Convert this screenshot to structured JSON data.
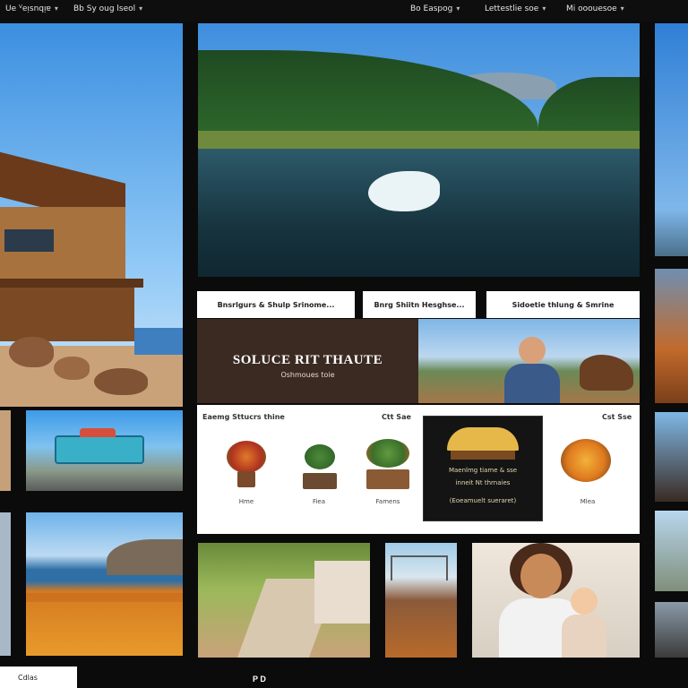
{
  "topbar": {
    "left_links": [
      "Ue ⱽeᴉsnqᴉɐ",
      "Bb Sy oug lseol"
    ],
    "right_links": [
      "Bo Easpog",
      "Lettestlie soe",
      "Mi ooouesoe"
    ]
  },
  "tabs": [
    "Bnsrlgurs & Shulp Srinome...",
    "Bnrg Shiitn Hesghse...",
    "Sidoetie thlung & Smrine"
  ],
  "hero": {
    "title": "SOLUCE RIT THAUTE",
    "subtitle": "Oshmoues toie"
  },
  "shop": {
    "heading_left": "Eaemg Sttucrs thine",
    "heading_mid": "Ctt Sae",
    "heading_right": "Cst Sse",
    "products": [
      {
        "label": "Hme",
        "icon": "flower-bouquet-icon"
      },
      {
        "label": "Fiea",
        "icon": "potted-plant-icon"
      },
      {
        "label": "Famens",
        "icon": "planter-box-icon"
      },
      {
        "label": "Mlea",
        "icon": "sunflower-bouquet-icon"
      }
    ],
    "featured": {
      "line1": "Maenlmg tiame & sse",
      "line2": "inneit Nt thrnaies",
      "line3": "(Eoeamuelt sueraret)"
    }
  },
  "footer": {
    "button_label": "Cdlas",
    "icon_label": "P D"
  },
  "colors": {
    "page_bg": "#0b0b0b",
    "hero_panel": "#3b2a22",
    "panel_white": "#ffffff"
  }
}
